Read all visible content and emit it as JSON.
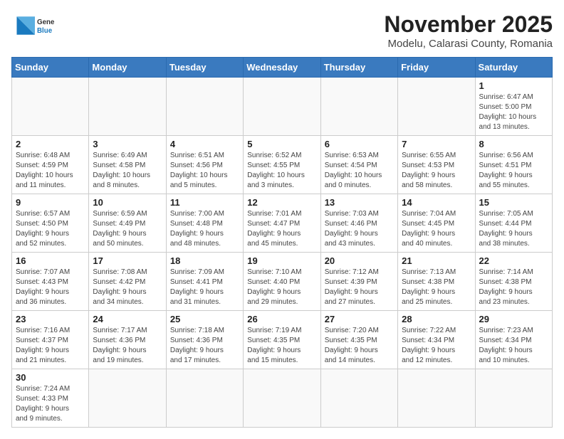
{
  "header": {
    "logo_general": "General",
    "logo_blue": "Blue",
    "month_title": "November 2025",
    "location": "Modelu, Calarasi County, Romania"
  },
  "weekdays": [
    "Sunday",
    "Monday",
    "Tuesday",
    "Wednesday",
    "Thursday",
    "Friday",
    "Saturday"
  ],
  "weeks": [
    [
      {
        "day": "",
        "info": ""
      },
      {
        "day": "",
        "info": ""
      },
      {
        "day": "",
        "info": ""
      },
      {
        "day": "",
        "info": ""
      },
      {
        "day": "",
        "info": ""
      },
      {
        "day": "",
        "info": ""
      },
      {
        "day": "1",
        "info": "Sunrise: 6:47 AM\nSunset: 5:00 PM\nDaylight: 10 hours\nand 13 minutes."
      }
    ],
    [
      {
        "day": "2",
        "info": "Sunrise: 6:48 AM\nSunset: 4:59 PM\nDaylight: 10 hours\nand 11 minutes."
      },
      {
        "day": "3",
        "info": "Sunrise: 6:49 AM\nSunset: 4:58 PM\nDaylight: 10 hours\nand 8 minutes."
      },
      {
        "day": "4",
        "info": "Sunrise: 6:51 AM\nSunset: 4:56 PM\nDaylight: 10 hours\nand 5 minutes."
      },
      {
        "day": "5",
        "info": "Sunrise: 6:52 AM\nSunset: 4:55 PM\nDaylight: 10 hours\nand 3 minutes."
      },
      {
        "day": "6",
        "info": "Sunrise: 6:53 AM\nSunset: 4:54 PM\nDaylight: 10 hours\nand 0 minutes."
      },
      {
        "day": "7",
        "info": "Sunrise: 6:55 AM\nSunset: 4:53 PM\nDaylight: 9 hours\nand 58 minutes."
      },
      {
        "day": "8",
        "info": "Sunrise: 6:56 AM\nSunset: 4:51 PM\nDaylight: 9 hours\nand 55 minutes."
      }
    ],
    [
      {
        "day": "9",
        "info": "Sunrise: 6:57 AM\nSunset: 4:50 PM\nDaylight: 9 hours\nand 52 minutes."
      },
      {
        "day": "10",
        "info": "Sunrise: 6:59 AM\nSunset: 4:49 PM\nDaylight: 9 hours\nand 50 minutes."
      },
      {
        "day": "11",
        "info": "Sunrise: 7:00 AM\nSunset: 4:48 PM\nDaylight: 9 hours\nand 48 minutes."
      },
      {
        "day": "12",
        "info": "Sunrise: 7:01 AM\nSunset: 4:47 PM\nDaylight: 9 hours\nand 45 minutes."
      },
      {
        "day": "13",
        "info": "Sunrise: 7:03 AM\nSunset: 4:46 PM\nDaylight: 9 hours\nand 43 minutes."
      },
      {
        "day": "14",
        "info": "Sunrise: 7:04 AM\nSunset: 4:45 PM\nDaylight: 9 hours\nand 40 minutes."
      },
      {
        "day": "15",
        "info": "Sunrise: 7:05 AM\nSunset: 4:44 PM\nDaylight: 9 hours\nand 38 minutes."
      }
    ],
    [
      {
        "day": "16",
        "info": "Sunrise: 7:07 AM\nSunset: 4:43 PM\nDaylight: 9 hours\nand 36 minutes."
      },
      {
        "day": "17",
        "info": "Sunrise: 7:08 AM\nSunset: 4:42 PM\nDaylight: 9 hours\nand 34 minutes."
      },
      {
        "day": "18",
        "info": "Sunrise: 7:09 AM\nSunset: 4:41 PM\nDaylight: 9 hours\nand 31 minutes."
      },
      {
        "day": "19",
        "info": "Sunrise: 7:10 AM\nSunset: 4:40 PM\nDaylight: 9 hours\nand 29 minutes."
      },
      {
        "day": "20",
        "info": "Sunrise: 7:12 AM\nSunset: 4:39 PM\nDaylight: 9 hours\nand 27 minutes."
      },
      {
        "day": "21",
        "info": "Sunrise: 7:13 AM\nSunset: 4:38 PM\nDaylight: 9 hours\nand 25 minutes."
      },
      {
        "day": "22",
        "info": "Sunrise: 7:14 AM\nSunset: 4:38 PM\nDaylight: 9 hours\nand 23 minutes."
      }
    ],
    [
      {
        "day": "23",
        "info": "Sunrise: 7:16 AM\nSunset: 4:37 PM\nDaylight: 9 hours\nand 21 minutes."
      },
      {
        "day": "24",
        "info": "Sunrise: 7:17 AM\nSunset: 4:36 PM\nDaylight: 9 hours\nand 19 minutes."
      },
      {
        "day": "25",
        "info": "Sunrise: 7:18 AM\nSunset: 4:36 PM\nDaylight: 9 hours\nand 17 minutes."
      },
      {
        "day": "26",
        "info": "Sunrise: 7:19 AM\nSunset: 4:35 PM\nDaylight: 9 hours\nand 15 minutes."
      },
      {
        "day": "27",
        "info": "Sunrise: 7:20 AM\nSunset: 4:35 PM\nDaylight: 9 hours\nand 14 minutes."
      },
      {
        "day": "28",
        "info": "Sunrise: 7:22 AM\nSunset: 4:34 PM\nDaylight: 9 hours\nand 12 minutes."
      },
      {
        "day": "29",
        "info": "Sunrise: 7:23 AM\nSunset: 4:34 PM\nDaylight: 9 hours\nand 10 minutes."
      }
    ],
    [
      {
        "day": "30",
        "info": "Sunrise: 7:24 AM\nSunset: 4:33 PM\nDaylight: 9 hours\nand 9 minutes."
      },
      {
        "day": "",
        "info": ""
      },
      {
        "day": "",
        "info": ""
      },
      {
        "day": "",
        "info": ""
      },
      {
        "day": "",
        "info": ""
      },
      {
        "day": "",
        "info": ""
      },
      {
        "day": "",
        "info": ""
      }
    ]
  ]
}
